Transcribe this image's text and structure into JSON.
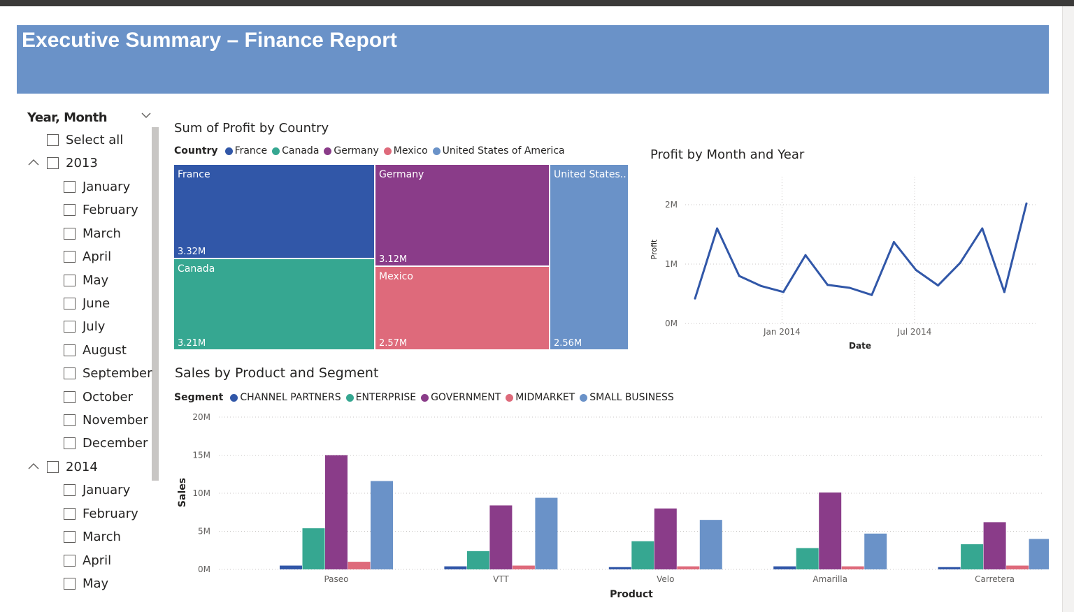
{
  "banner": {
    "title": "Executive Summary – Finance Report"
  },
  "slicer": {
    "title": "Year, Month",
    "select_all": "Select all",
    "years": [
      {
        "label": "2013",
        "months": [
          "January",
          "February",
          "March",
          "April",
          "May",
          "June",
          "July",
          "August",
          "September",
          "October",
          "November",
          "December"
        ]
      },
      {
        "label": "2014",
        "months": [
          "January",
          "February",
          "March",
          "April",
          "May"
        ]
      }
    ]
  },
  "colors": {
    "banner": "#6a92c8",
    "france": "#3157a8",
    "canada": "#36a791",
    "germany": "#8a3c89",
    "mexico": "#de6a7b",
    "usa": "#6a92c8"
  },
  "treemap": {
    "title": "Sum of Profit by Country",
    "legend_title": "Country",
    "legend": [
      "France",
      "Canada",
      "Germany",
      "Mexico",
      "United States of America"
    ],
    "tiles": [
      {
        "name": "France",
        "value": "3.32M"
      },
      {
        "name": "Canada",
        "value": "3.21M"
      },
      {
        "name": "Germany",
        "value": "3.12M"
      },
      {
        "name": "Mexico",
        "value": "2.57M"
      },
      {
        "name": "United States...",
        "value": "2.56M"
      }
    ]
  },
  "chart_data": [
    {
      "type": "line",
      "title": "Profit by Month and Year",
      "xlabel": "Date",
      "ylabel": "Profit",
      "x": [
        "2013-09",
        "2013-10",
        "2013-11",
        "2013-12",
        "2014-01",
        "2014-02",
        "2014-03",
        "2014-04",
        "2014-05",
        "2014-06",
        "2014-07",
        "2014-08",
        "2014-09",
        "2014-10",
        "2014-11",
        "2014-12"
      ],
      "y": [
        0.42,
        1.6,
        0.8,
        0.63,
        0.53,
        1.15,
        0.65,
        0.6,
        0.48,
        1.37,
        0.9,
        0.64,
        1.02,
        1.6,
        0.53,
        2.02
      ],
      "y_unit": "M",
      "ylim": [
        0,
        2.2
      ],
      "yticks": [
        "0M",
        "1M",
        "2M"
      ],
      "xticks": [
        "Jan 2014",
        "Jul 2014"
      ],
      "grid": true
    },
    {
      "type": "bar",
      "title": "Sales by Product and Segment",
      "legend_title": "Segment",
      "xlabel": "Product",
      "ylabel": "Sales",
      "categories": [
        "Paseo",
        "VTT",
        "Velo",
        "Amarilla",
        "Carretera"
      ],
      "series": [
        {
          "name": "CHANNEL PARTNERS",
          "values": [
            0.5,
            0.4,
            0.3,
            0.4,
            0.3
          ]
        },
        {
          "name": "ENTERPRISE",
          "values": [
            5.4,
            2.4,
            3.7,
            2.8,
            3.3
          ]
        },
        {
          "name": "GOVERNMENT",
          "values": [
            15.0,
            8.4,
            8.0,
            10.1,
            6.2
          ]
        },
        {
          "name": "MIDMARKET",
          "values": [
            1.0,
            0.5,
            0.4,
            0.4,
            0.5
          ]
        },
        {
          "name": "SMALL BUSINESS",
          "values": [
            11.6,
            9.4,
            6.5,
            4.7,
            4.0
          ]
        }
      ],
      "series_colors": [
        "#3157a8",
        "#36a791",
        "#8a3c89",
        "#de6a7b",
        "#6a92c8"
      ],
      "y_unit": "M",
      "ylim": [
        0,
        20
      ],
      "yticks": [
        "0M",
        "5M",
        "10M",
        "15M",
        "20M"
      ],
      "grid": true
    }
  ]
}
